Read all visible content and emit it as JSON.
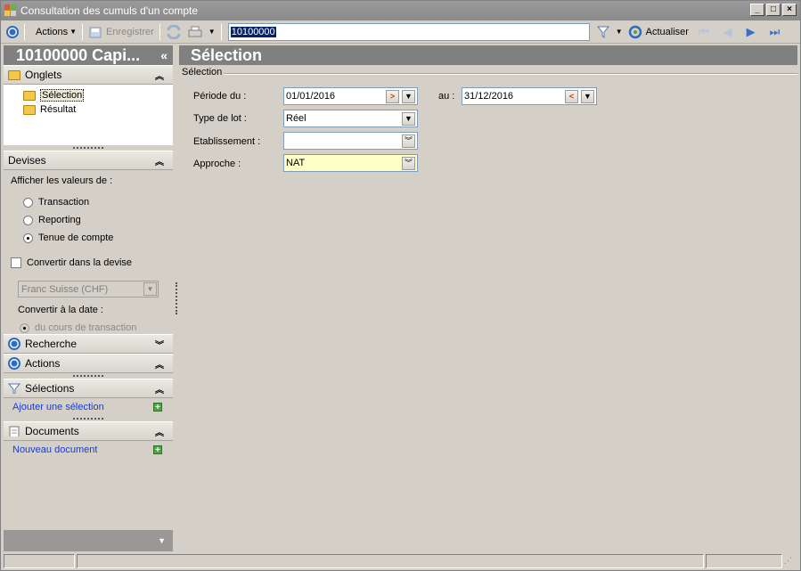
{
  "window": {
    "title": "Consultation des cumuls d'un compte",
    "buttons": {
      "minimize": "_",
      "maximize": "□",
      "close": "×"
    }
  },
  "toolbar": {
    "actions_label": "Actions",
    "save_label": "Enregistrer",
    "search_value": "10100000",
    "refresh_label": "Actualiser"
  },
  "left": {
    "header": "10100000 Capi...",
    "collapse_glyph": "«",
    "onglets": {
      "title": "Onglets",
      "items": [
        {
          "label": "Sélection",
          "selected": true
        },
        {
          "label": "Résultat",
          "selected": false
        }
      ]
    },
    "devises": {
      "title": "Devises",
      "prompt": "Afficher les valeurs de :",
      "options": [
        {
          "label": "Transaction",
          "checked": false
        },
        {
          "label": "Reporting",
          "checked": false
        },
        {
          "label": "Tenue de compte",
          "checked": true
        }
      ],
      "convert_label": "Convertir dans la devise",
      "currency": "Franc Suisse (CHF)",
      "date_label": "Convertir à la date :",
      "date_option": "du cours de transaction"
    },
    "recherche": {
      "title": "Recherche"
    },
    "actions": {
      "title": "Actions"
    },
    "selections": {
      "title": "Sélections",
      "link": "Ajouter une sélection"
    },
    "documents": {
      "title": "Documents",
      "link": "Nouveau document"
    }
  },
  "main": {
    "header": "Sélection",
    "group_label": "Sélection",
    "fields": {
      "periode_label": "Période du :",
      "periode_from": "01/01/2016",
      "au_label": "au :",
      "periode_to": "31/12/2016",
      "type_label": "Type de lot :",
      "type_value": "Réel",
      "etab_label": "Etablissement :",
      "etab_value": "",
      "approche_label": "Approche :",
      "approche_value": "NAT"
    }
  },
  "colors": {
    "header_gray": "#808080",
    "accent_blue": "#2d6cc0",
    "link_blue": "#1a3ccc",
    "highlight_yellow": "#ffffc8",
    "folder_yellow": "#f2c84b"
  }
}
